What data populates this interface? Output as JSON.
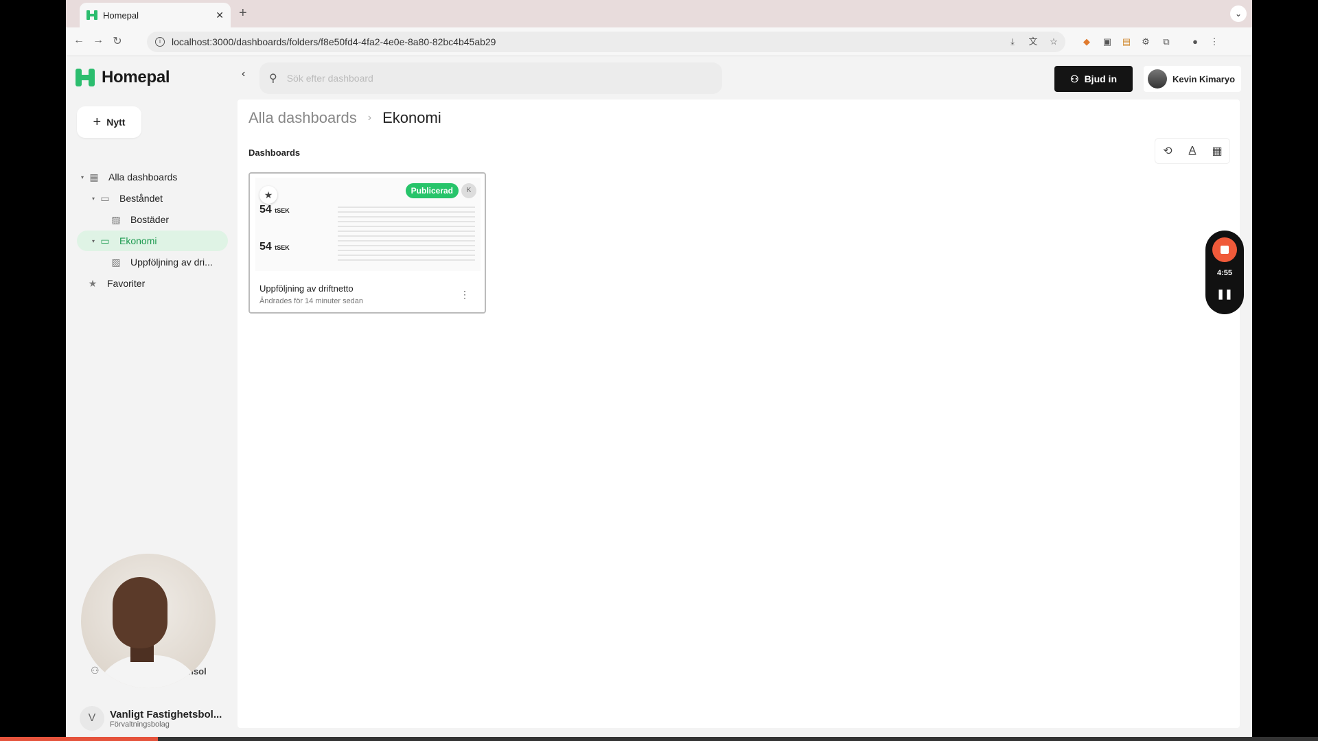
{
  "browser": {
    "tab_title": "Homepal",
    "new_tab": "+",
    "url": "localhost:3000/dashboards/folders/f8e50fd4-4fa2-4e0e-8a80-82bc4b45ab29"
  },
  "app": {
    "logo": "Homepal",
    "new_button": "Nytt",
    "search_placeholder": "Sök efter dashboard",
    "invite_button": "Bjud in",
    "user_name": "Kevin Kimaryo"
  },
  "sidebar": {
    "items": [
      {
        "label": "Alla dashboards"
      },
      {
        "label": "Beståndet"
      },
      {
        "label": "Bostäder"
      },
      {
        "label": "Ekonomi"
      },
      {
        "label": "Uppföljning av dri..."
      },
      {
        "label": "Favoriter"
      }
    ],
    "konsol": "nsol",
    "org_initial": "V",
    "org_name": "Vanligt Fastighetsbol...",
    "org_sub": "Förvaltningsbolag"
  },
  "main": {
    "breadcrumb_root": "Alla dashboards",
    "breadcrumb_current": "Ekonomi",
    "section_title": "Dashboards",
    "card": {
      "badge": "Publicerad",
      "avatar": "K",
      "kpi1": "54",
      "kpi2": "54",
      "kpi_unit": "tSEK",
      "title": "Uppföljning av driftnetto",
      "subtitle": "Ändrades för 14 minuter sedan"
    }
  },
  "recorder": {
    "time": "4:55",
    "progress_fraction": 0.12
  },
  "colors": {
    "brand_green": "#2bbd6e",
    "record_red": "#f05a3a"
  }
}
